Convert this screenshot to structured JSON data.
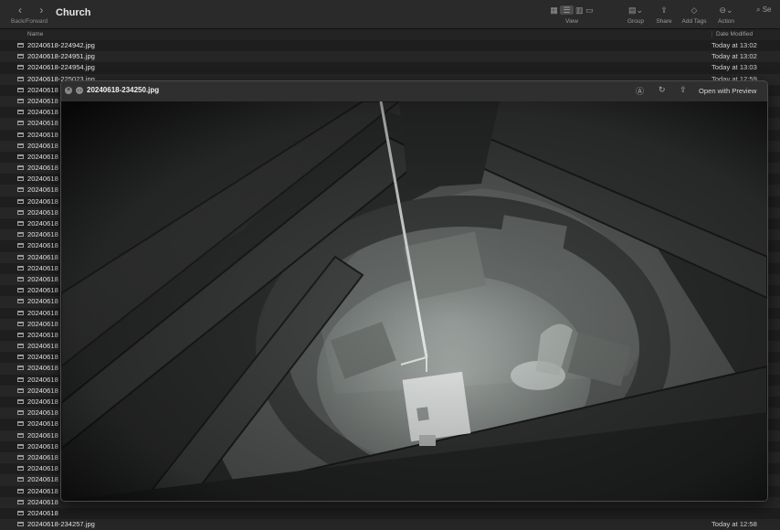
{
  "window": {
    "title": "Church"
  },
  "nav": {
    "back_forward_label": "Back/Forward"
  },
  "toolbar": {
    "view_label": "View",
    "group_label": "Group",
    "share_label": "Share",
    "tags_label": "Add Tags",
    "action_label": "Action",
    "search_partial": "Se"
  },
  "columns": {
    "name": "Name",
    "date": "Date Modified"
  },
  "files": [
    {
      "name": "20240618-224942.jpg",
      "date": "Today at 13:02"
    },
    {
      "name": "20240618-224951.jpg",
      "date": "Today at 13:02"
    },
    {
      "name": "20240618-224954.jpg",
      "date": "Today at 13:03"
    },
    {
      "name": "20240618-225023.jpg",
      "date": "Today at 12:59"
    },
    {
      "name": "20240618",
      "date": ""
    },
    {
      "name": "20240618",
      "date": ""
    },
    {
      "name": "20240618",
      "date": ""
    },
    {
      "name": "20240618",
      "date": ""
    },
    {
      "name": "20240618",
      "date": ""
    },
    {
      "name": "20240618",
      "date": ""
    },
    {
      "name": "20240618",
      "date": ""
    },
    {
      "name": "20240618",
      "date": ""
    },
    {
      "name": "20240618",
      "date": ""
    },
    {
      "name": "20240618",
      "date": ""
    },
    {
      "name": "20240618",
      "date": ""
    },
    {
      "name": "20240618",
      "date": ""
    },
    {
      "name": "20240618",
      "date": ""
    },
    {
      "name": "20240618",
      "date": ""
    },
    {
      "name": "20240618",
      "date": ""
    },
    {
      "name": "20240618",
      "date": ""
    },
    {
      "name": "20240618",
      "date": ""
    },
    {
      "name": "20240618",
      "date": ""
    },
    {
      "name": "20240618",
      "date": ""
    },
    {
      "name": "20240618",
      "date": ""
    },
    {
      "name": "20240618",
      "date": ""
    },
    {
      "name": "20240618",
      "date": ""
    },
    {
      "name": "20240618",
      "date": ""
    },
    {
      "name": "20240618",
      "date": ""
    },
    {
      "name": "20240618",
      "date": ""
    },
    {
      "name": "20240618",
      "date": ""
    },
    {
      "name": "20240618",
      "date": ""
    },
    {
      "name": "20240618",
      "date": ""
    },
    {
      "name": "20240618",
      "date": ""
    },
    {
      "name": "20240618",
      "date": ""
    },
    {
      "name": "20240618",
      "date": ""
    },
    {
      "name": "20240618",
      "date": ""
    },
    {
      "name": "20240618",
      "date": ""
    },
    {
      "name": "20240618",
      "date": ""
    },
    {
      "name": "20240618",
      "date": ""
    },
    {
      "name": "20240618",
      "date": ""
    },
    {
      "name": "20240618",
      "date": ""
    },
    {
      "name": "20240618",
      "date": ""
    },
    {
      "name": "20240618",
      "date": ""
    },
    {
      "name": "20240618-234257.jpg",
      "date": "Today at 12:58"
    }
  ],
  "quicklook": {
    "filename": "20240618-234250.jpg",
    "open_with": "Open with Preview",
    "close_icon": "close-icon",
    "fullscreen_icon": "fullscreen-icon",
    "markup_icon": "markup-icon",
    "rotate_icon": "rotate-icon",
    "share_icon": "share-icon"
  }
}
